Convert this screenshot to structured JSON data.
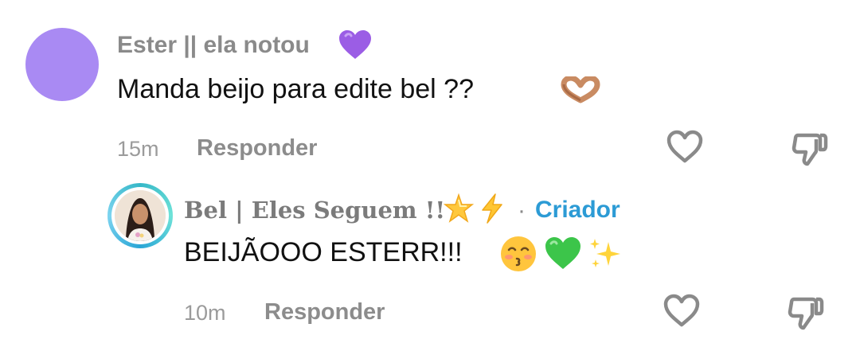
{
  "comments": [
    {
      "username": "Ester || ela notou",
      "text": "Manda beijo para edite bel ??",
      "time": "15m",
      "reply_label": "Responder",
      "icons": [
        "purple-heart-icon",
        "heart-hands-icon",
        "like-heart-icon",
        "dislike-icon"
      ]
    },
    {
      "username": "Bel | Eles Seguem !!",
      "separator": "·",
      "badge": "Criador",
      "text": "BEIJÃOOO ESTERR!!!",
      "time": "10m",
      "reply_label": "Responder",
      "icons": [
        "glowing-star-icon",
        "lightning-icon",
        "kissing-face-icon",
        "green-heart-icon",
        "sparkles-icon",
        "like-heart-icon",
        "dislike-icon"
      ]
    }
  ],
  "colors": {
    "avatar_purple": "#a98af3",
    "creator_badge": "#2c9bd5",
    "meta_gray": "#8c8c8c"
  }
}
